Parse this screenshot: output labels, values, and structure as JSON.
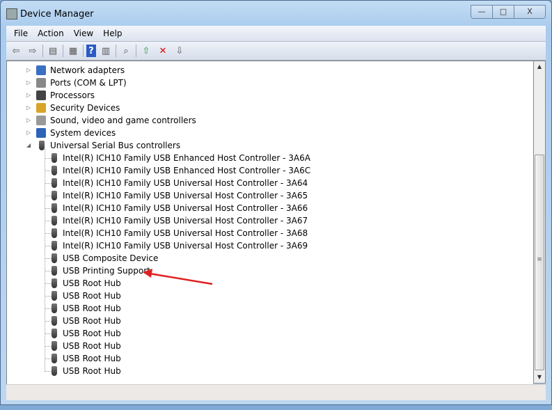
{
  "window": {
    "title": "Device Manager",
    "minimize": "—",
    "maximize": "□",
    "close": "X"
  },
  "menu": [
    "File",
    "Action",
    "View",
    "Help"
  ],
  "toolbar": [
    "back-icon",
    "forward-icon",
    "show-hide-console-tree-icon",
    "properties-icon",
    "help-icon",
    "action-pane-icon",
    "scan-hardware-icon",
    "update-driver-icon",
    "uninstall-icon",
    "disable-icon"
  ],
  "tree": {
    "categories": [
      {
        "label": "Network adapters",
        "color": "#3a6fc4"
      },
      {
        "label": "Ports (COM & LPT)",
        "color": "#888888"
      },
      {
        "label": "Processors",
        "color": "#444444"
      },
      {
        "label": "Security Devices",
        "color": "#d8a52a"
      },
      {
        "label": "Sound, video and game controllers",
        "color": "#999999"
      },
      {
        "label": "System devices",
        "color": "#2e64b8"
      },
      {
        "label": "Universal Serial Bus controllers",
        "color": "#444444"
      }
    ],
    "usb_children": [
      "Intel(R) ICH10 Family USB Enhanced Host Controller - 3A6A",
      "Intel(R) ICH10 Family USB Enhanced Host Controller - 3A6C",
      "Intel(R) ICH10 Family USB Universal Host Controller - 3A64",
      "Intel(R) ICH10 Family USB Universal Host Controller - 3A65",
      "Intel(R) ICH10 Family USB Universal Host Controller - 3A66",
      "Intel(R) ICH10 Family USB Universal Host Controller - 3A67",
      "Intel(R) ICH10 Family USB Universal Host Controller - 3A68",
      "Intel(R) ICH10 Family USB Universal Host Controller - 3A69",
      "USB Composite Device",
      "USB Printing Support",
      "USB Root Hub",
      "USB Root Hub",
      "USB Root Hub",
      "USB Root Hub",
      "USB Root Hub",
      "USB Root Hub",
      "USB Root Hub",
      "USB Root Hub"
    ]
  },
  "annotation": {
    "color": "#e02020",
    "target": "USB Printing Support"
  }
}
